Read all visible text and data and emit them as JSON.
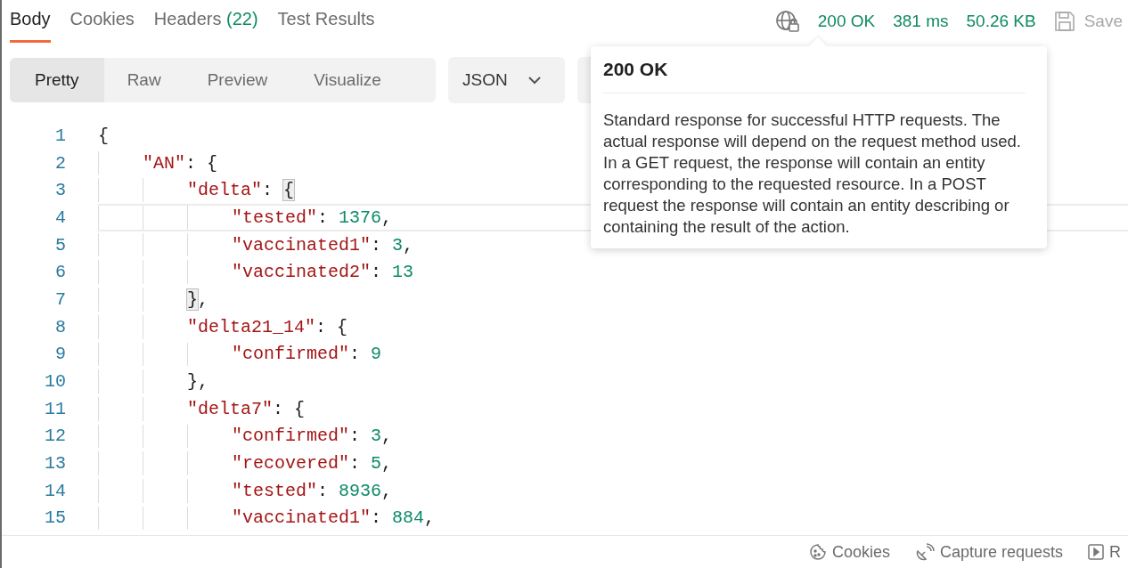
{
  "tabs": [
    {
      "label": "Body",
      "selected": true
    },
    {
      "label": "Cookies",
      "selected": false
    },
    {
      "label": "Headers",
      "count": "(22)",
      "selected": false
    },
    {
      "label": "Test Results",
      "selected": false
    }
  ],
  "response_meta": {
    "status": "200 OK",
    "time": "381 ms",
    "size": "50.26 KB",
    "save": "Save"
  },
  "view_modes": [
    {
      "label": "Pretty",
      "selected": true
    },
    {
      "label": "Raw",
      "selected": false
    },
    {
      "label": "Preview",
      "selected": false
    },
    {
      "label": "Visualize",
      "selected": false
    }
  ],
  "format": "JSON",
  "code_lines": [
    {
      "number": "1",
      "current": false,
      "tokens": [
        {
          "kind": "punct",
          "text": "{"
        }
      ],
      "children": [
        {
          "number": "2",
          "current": false,
          "tokens": [
            {
              "kind": "key",
              "text": "\"AN\""
            },
            {
              "kind": "punct",
              "text": ": {"
            }
          ],
          "children": [
            {
              "number": "3",
              "current": false,
              "tokens": [
                {
                  "kind": "key",
                  "text": "\"delta\""
                },
                {
                  "kind": "punct",
                  "text": ": "
                },
                {
                  "kind": "bracket-match",
                  "text": "{"
                }
              ],
              "children": [
                {
                  "number": "4",
                  "current": true,
                  "tokens": [
                    {
                      "kind": "key",
                      "text": "\"tested\""
                    },
                    {
                      "kind": "punct",
                      "text": ": "
                    },
                    {
                      "kind": "number",
                      "text": "1376"
                    },
                    {
                      "kind": "punct",
                      "text": ","
                    }
                  ]
                },
                {
                  "number": "5",
                  "current": false,
                  "tokens": [
                    {
                      "kind": "key",
                      "text": "\"vaccinated1\""
                    },
                    {
                      "kind": "punct",
                      "text": ": "
                    },
                    {
                      "kind": "number",
                      "text": "3"
                    },
                    {
                      "kind": "punct",
                      "text": ","
                    }
                  ]
                },
                {
                  "number": "6",
                  "current": false,
                  "tokens": [
                    {
                      "kind": "key",
                      "text": "\"vaccinated2\""
                    },
                    {
                      "kind": "punct",
                      "text": ": "
                    },
                    {
                      "kind": "number",
                      "text": "13"
                    }
                  ]
                }
              ]
            },
            {
              "number": "7",
              "current": false,
              "tokens": [
                {
                  "kind": "bracket-match",
                  "text": "}"
                },
                {
                  "kind": "punct",
                  "text": ","
                }
              ]
            },
            {
              "number": "8",
              "current": false,
              "tokens": [
                {
                  "kind": "key",
                  "text": "\"delta21_14\""
                },
                {
                  "kind": "punct",
                  "text": ": {"
                }
              ],
              "children": [
                {
                  "number": "9",
                  "current": false,
                  "tokens": [
                    {
                      "kind": "key",
                      "text": "\"confirmed\""
                    },
                    {
                      "kind": "punct",
                      "text": ": "
                    },
                    {
                      "kind": "number",
                      "text": "9"
                    }
                  ]
                }
              ]
            },
            {
              "number": "10",
              "current": false,
              "tokens": [
                {
                  "kind": "punct",
                  "text": "},"
                }
              ]
            },
            {
              "number": "11",
              "current": false,
              "tokens": [
                {
                  "kind": "key",
                  "text": "\"delta7\""
                },
                {
                  "kind": "punct",
                  "text": ": {"
                }
              ],
              "children": [
                {
                  "number": "12",
                  "current": false,
                  "tokens": [
                    {
                      "kind": "key",
                      "text": "\"confirmed\""
                    },
                    {
                      "kind": "punct",
                      "text": ": "
                    },
                    {
                      "kind": "number",
                      "text": "3"
                    },
                    {
                      "kind": "punct",
                      "text": ","
                    }
                  ]
                },
                {
                  "number": "13",
                  "current": false,
                  "tokens": [
                    {
                      "kind": "key",
                      "text": "\"recovered\""
                    },
                    {
                      "kind": "punct",
                      "text": ": "
                    },
                    {
                      "kind": "number",
                      "text": "5"
                    },
                    {
                      "kind": "punct",
                      "text": ","
                    }
                  ]
                },
                {
                  "number": "14",
                  "current": false,
                  "tokens": [
                    {
                      "kind": "key",
                      "text": "\"tested\""
                    },
                    {
                      "kind": "punct",
                      "text": ": "
                    },
                    {
                      "kind": "number",
                      "text": "8936"
                    },
                    {
                      "kind": "punct",
                      "text": ","
                    }
                  ]
                },
                {
                  "number": "15",
                  "current": false,
                  "tokens": [
                    {
                      "kind": "key",
                      "text": "\"vaccinated1\""
                    },
                    {
                      "kind": "punct",
                      "text": ": "
                    },
                    {
                      "kind": "number",
                      "text": "884"
                    },
                    {
                      "kind": "punct",
                      "text": ","
                    }
                  ]
                }
              ]
            }
          ]
        }
      ]
    }
  ],
  "tooltip": {
    "title": "200 OK",
    "text": "Standard response for successful HTTP requests. The actual response will depend on the request method used. In a GET request, the response will contain an entity corresponding to the requested resource. In a POST request the response will contain an entity describing or containing the result of the action."
  },
  "status_bar": {
    "items": [
      {
        "kind": "cookies",
        "label": "Cookies"
      },
      {
        "kind": "capture",
        "label": "Capture requests"
      },
      {
        "kind": "runner",
        "label": "R"
      }
    ]
  }
}
